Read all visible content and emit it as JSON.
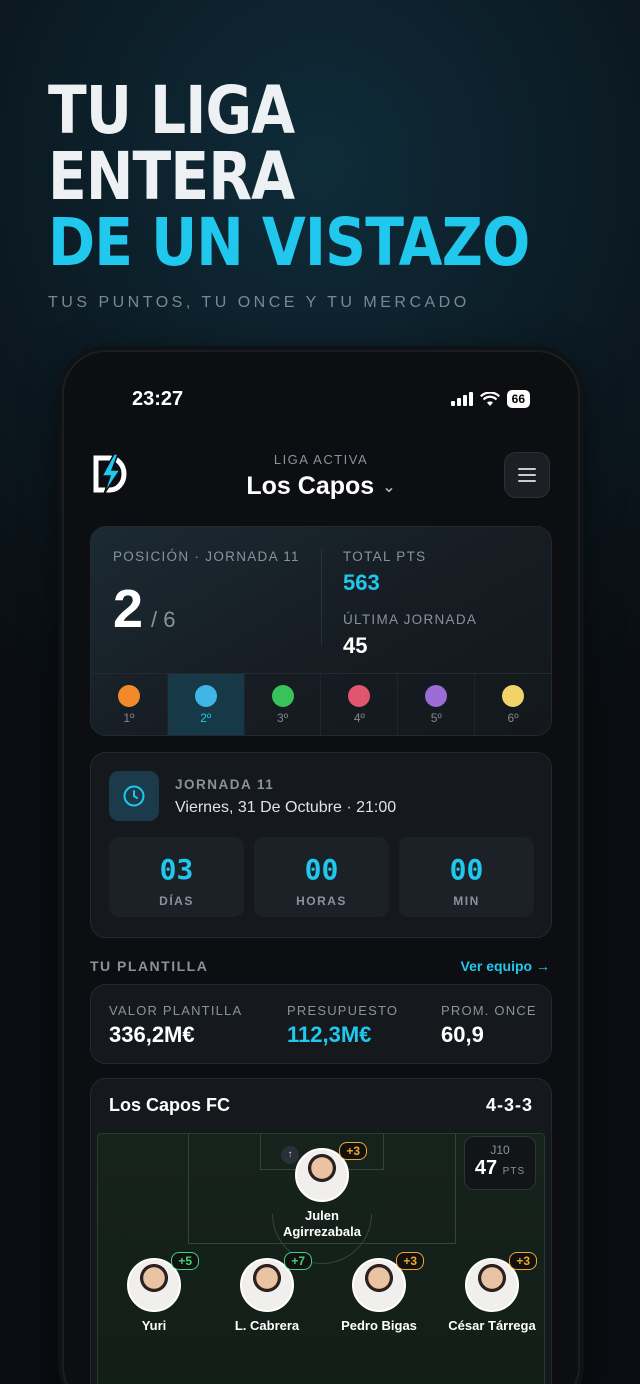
{
  "hero": {
    "line1": "TU LIGA ENTERA",
    "line2": "DE UN VISTAZO",
    "subtitle": "TUS PUNTOS, TU ONCE Y TU MERCADO"
  },
  "status_bar": {
    "time": "23:27",
    "battery": "66"
  },
  "header": {
    "league_caption": "LIGA ACTIVA",
    "league_name": "Los Capos"
  },
  "position_card": {
    "caption": "POSICIÓN · JORNADA 11",
    "position": "2",
    "of_total": "/ 6",
    "total_caption": "TOTAL PTS",
    "total_value": "563",
    "last_caption": "ÚLTIMA JORNADA",
    "last_value": "45",
    "ranks": [
      {
        "label": "1º",
        "color": "#f08a2a"
      },
      {
        "label": "2º",
        "color": "#3fb6e6"
      },
      {
        "label": "3º",
        "color": "#38c25a"
      },
      {
        "label": "4º",
        "color": "#e0566e"
      },
      {
        "label": "5º",
        "color": "#9b6bd6"
      },
      {
        "label": "6º",
        "color": "#f1d36a"
      }
    ],
    "active_rank_index": 1
  },
  "match_card": {
    "caption": "JORNADA 11",
    "date": "Viernes, 31 De Octubre · 21:00",
    "countdown": [
      {
        "value": "03",
        "label": "DÍAS"
      },
      {
        "value": "00",
        "label": "HORAS"
      },
      {
        "value": "00",
        "label": "MIN"
      }
    ]
  },
  "squad_section": {
    "title": "TU PLANTILLA",
    "link": "Ver equipo →",
    "stats": [
      {
        "label": "VALOR PLANTILLA",
        "value": "336,2M€"
      },
      {
        "label": "PRESUPUESTO",
        "value": "112,3M€"
      },
      {
        "label": "PROM. ONCE",
        "value": "60,9"
      }
    ]
  },
  "team_card": {
    "name": "Los Capos FC",
    "formation": "4-3-3",
    "jornada_label": "J10",
    "jornada_points": "47",
    "jornada_unit": "PTS",
    "goalkeeper": {
      "name_line1": "Julen",
      "name_line2": "Agirrezabala",
      "points": "+3",
      "badge_color": "orange",
      "captain_icon": "↑"
    },
    "defenders": [
      {
        "name": "Yuri",
        "points": "+5",
        "badge_color": "green"
      },
      {
        "name": "L. Cabrera",
        "points": "+7",
        "badge_color": "green"
      },
      {
        "name": "Pedro Bigas",
        "points": "+3",
        "badge_color": "orange"
      },
      {
        "name": "César Tárrega",
        "points": "+3",
        "badge_color": "orange"
      }
    ]
  },
  "colors": {
    "accent": "#21c8ee",
    "background": "#0a0d11",
    "card": "#15191e"
  }
}
